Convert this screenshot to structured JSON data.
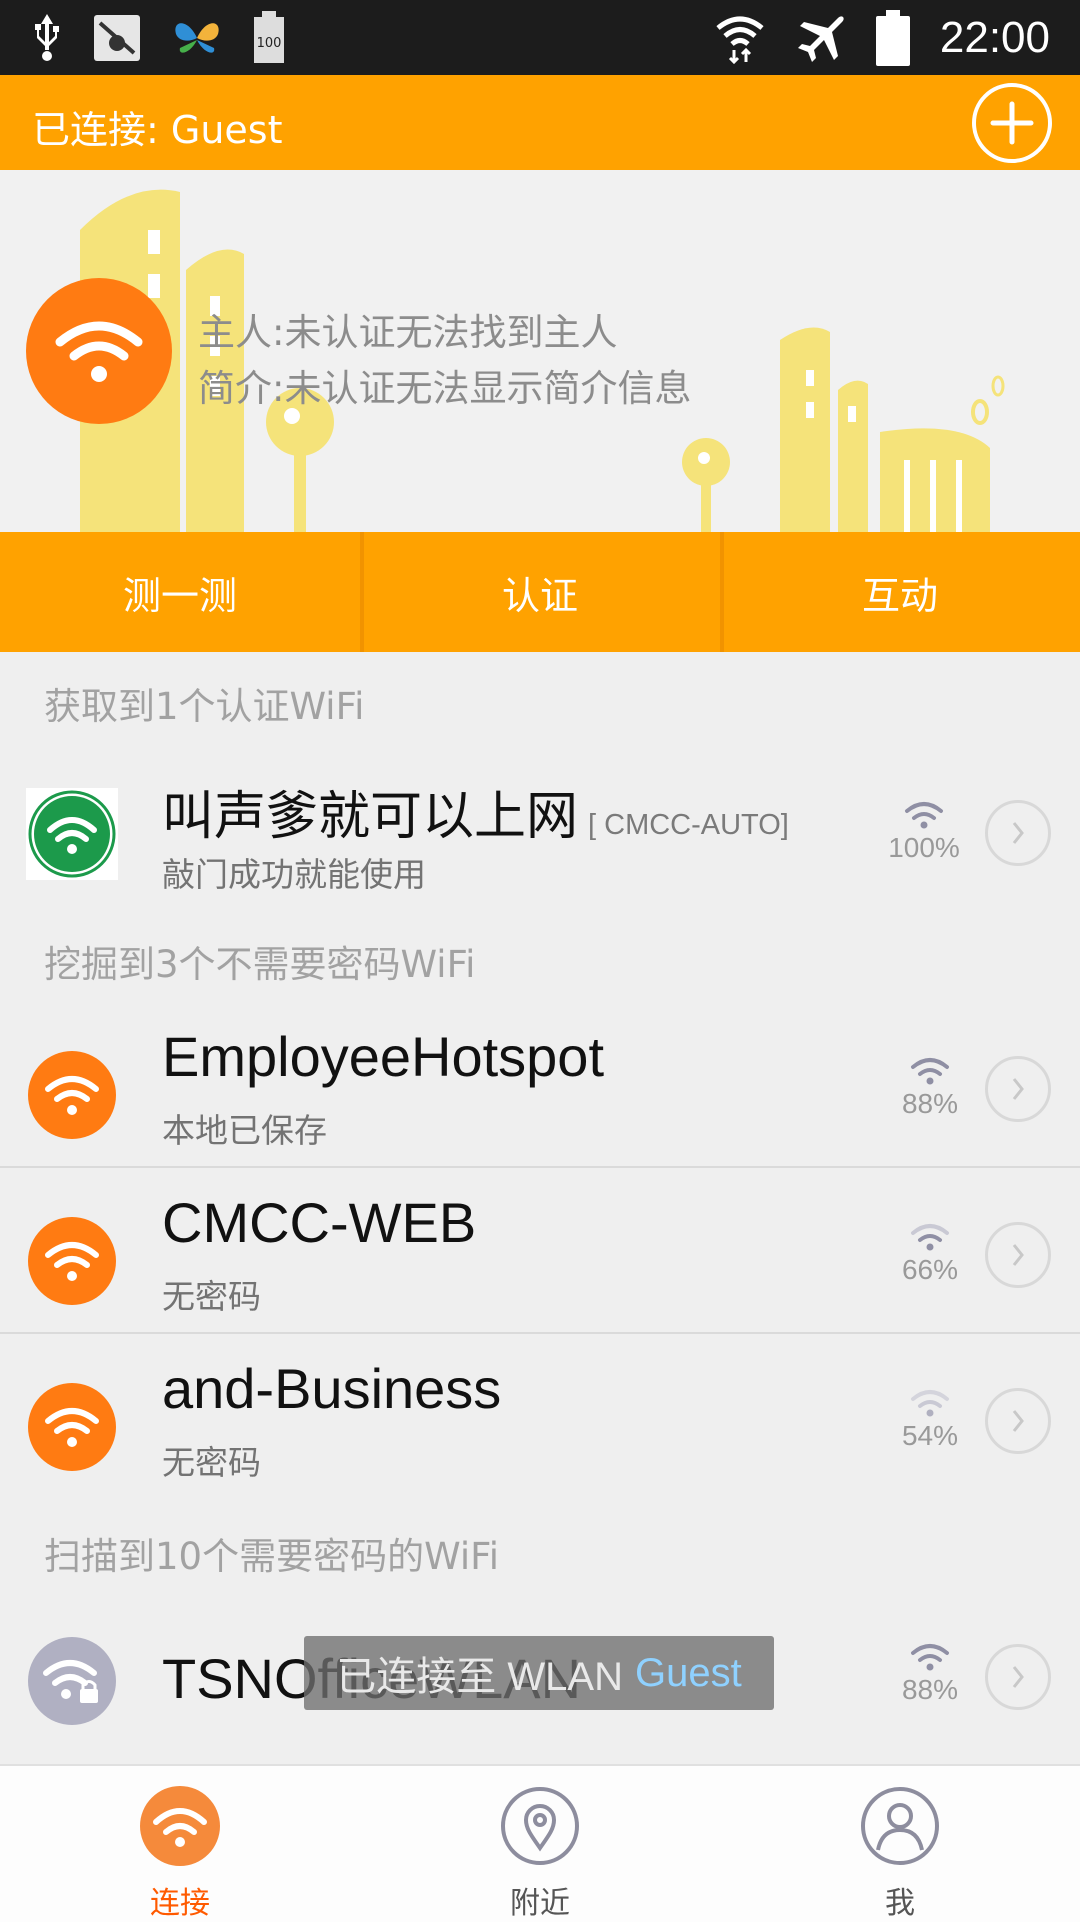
{
  "status_bar": {
    "time": "22:00",
    "battery_badge": "100",
    "left_icons": [
      "usb-icon",
      "debug-icon",
      "butterfly-app-icon",
      "battery-full-badge-icon"
    ],
    "right_icons": [
      "wifi-signal-icon",
      "airplane-mode-icon",
      "battery-icon"
    ]
  },
  "header": {
    "title": "已连接: Guest",
    "add_icon": "plus-circle-icon"
  },
  "banner": {
    "owner": "主人:未认证无法找到主人",
    "intro": "简介:未认证无法显示简介信息"
  },
  "actions": [
    {
      "label": "测一测"
    },
    {
      "label": "认证"
    },
    {
      "label": "互动"
    }
  ],
  "sections": {
    "certified": "获取到1个认证WiFi",
    "open": "挖掘到3个不需要密码WiFi",
    "secured": "扫描到10个需要密码的WiFi"
  },
  "networks": [
    {
      "name": "叫声爹就可以上网",
      "tag": "[ CMCC-AUTO]",
      "sub": "敲门成功就能使用",
      "signal": "100%"
    },
    {
      "name": "EmployeeHotspot",
      "sub": "本地已保存",
      "signal": "88%"
    },
    {
      "name": "CMCC-WEB",
      "sub": "无密码",
      "signal": "66%"
    },
    {
      "name": "and-Business",
      "sub": "无密码",
      "signal": "54%"
    },
    {
      "name": "TSNOfficeWLAN",
      "sub": "",
      "signal": "88%"
    }
  ],
  "toast": {
    "text": "已连接至 WLAN",
    "highlight": "Guest"
  },
  "bottom_nav": [
    {
      "label": "连接",
      "icon": "wifi-icon",
      "active": true
    },
    {
      "label": "附近",
      "icon": "location-pin-icon",
      "active": false
    },
    {
      "label": "我",
      "icon": "user-profile-icon",
      "active": false
    }
  ],
  "colors": {
    "brand_orange": "#ffa200",
    "wifi_orange": "#ff7b12",
    "active_nav": "#ff5a00"
  }
}
